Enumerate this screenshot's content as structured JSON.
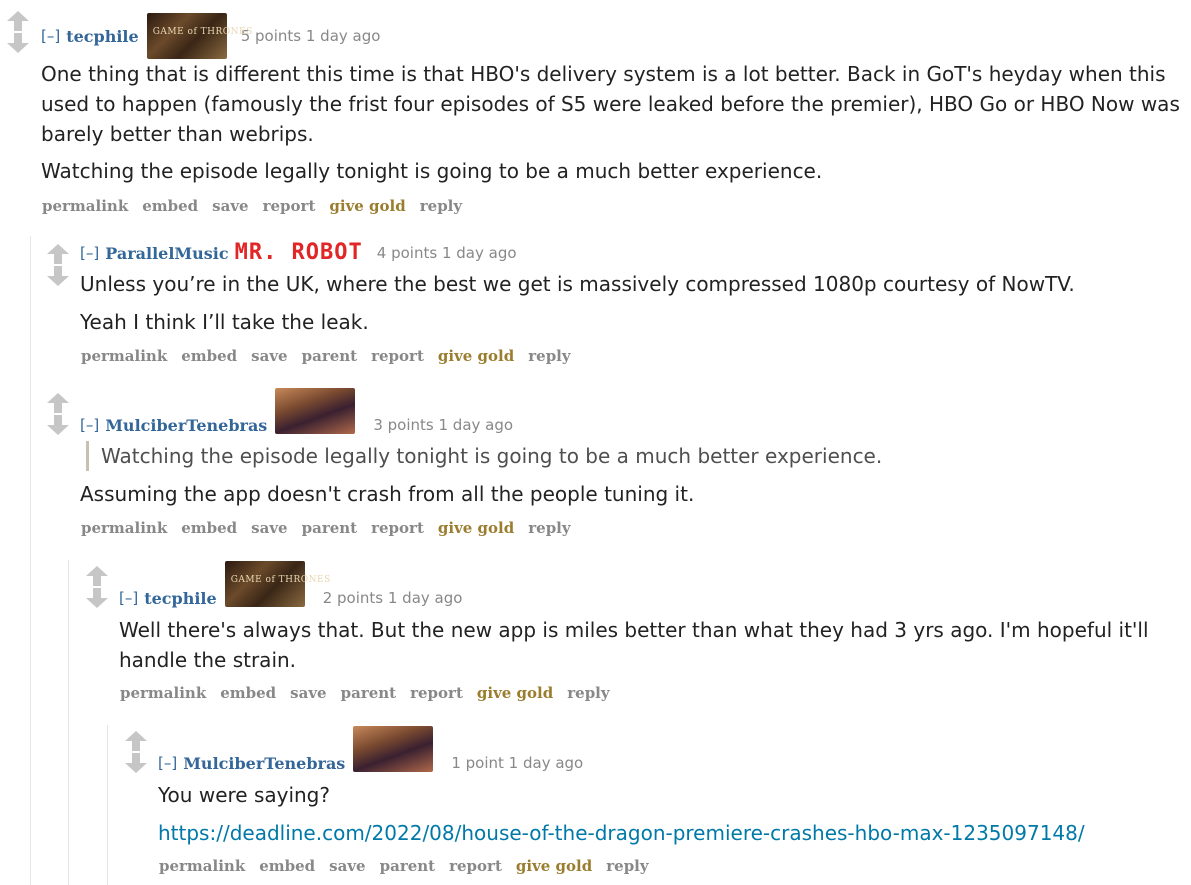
{
  "comments": [
    {
      "expand": "[–]",
      "author": "tecphile",
      "flair_text": "GAME of THRONES",
      "score": "5 points",
      "age": "1 day ago",
      "paragraphs": [
        "One thing that is different this time is that HBO's delivery system is a lot better. Back in GoT's heyday when this used to happen (famously the frist four episodes of S5 were leaked before the premier), HBO Go or HBO Now was barely better than webrips.",
        "Watching the episode legally tonight is going to be a much better experience."
      ],
      "buttons": [
        "permalink",
        "embed",
        "save",
        "report",
        "give gold",
        "reply"
      ]
    },
    {
      "expand": "[–]",
      "author": "ParallelMusic",
      "flair_text": "MR. ROBOT",
      "score": "4 points",
      "age": "1 day ago",
      "paragraphs": [
        "Unless you’re in the UK, where the best we get is massively compressed 1080p courtesy of NowTV.",
        "Yeah I think I’ll take the leak."
      ],
      "buttons": [
        "permalink",
        "embed",
        "save",
        "parent",
        "report",
        "give gold",
        "reply"
      ]
    },
    {
      "expand": "[–]",
      "author": "MulciberTenebras",
      "score": "3 points",
      "age": "1 day ago",
      "quote": "Watching the episode legally tonight is going to be a much better experience.",
      "paragraphs": [
        "Assuming the app doesn't crash from all the people tuning it."
      ],
      "buttons": [
        "permalink",
        "embed",
        "save",
        "parent",
        "report",
        "give gold",
        "reply"
      ]
    },
    {
      "expand": "[–]",
      "author": "tecphile",
      "flair_text": "GAME of THRONES",
      "score": "2 points",
      "age": "1 day ago",
      "paragraphs": [
        "Well there's always that. But the new app is miles better than what they had 3 yrs ago. I'm hopeful it'll handle the strain."
      ],
      "buttons": [
        "permalink",
        "embed",
        "save",
        "parent",
        "report",
        "give gold",
        "reply"
      ]
    },
    {
      "expand": "[–]",
      "author": "MulciberTenebras",
      "score": "1 point",
      "age": "1 day ago",
      "paragraphs": [
        "You were saying?"
      ],
      "link": "https://deadline.com/2022/08/house-of-the-dragon-premiere-crashes-hbo-max-1235097148/",
      "buttons": [
        "permalink",
        "embed",
        "save",
        "parent",
        "report",
        "give gold",
        "reply"
      ]
    }
  ],
  "colors": {
    "author": "#336699",
    "meta": "#888888",
    "gold": "#9a7d2e",
    "link": "#0079a8",
    "arrow": "#c6c6c6"
  }
}
